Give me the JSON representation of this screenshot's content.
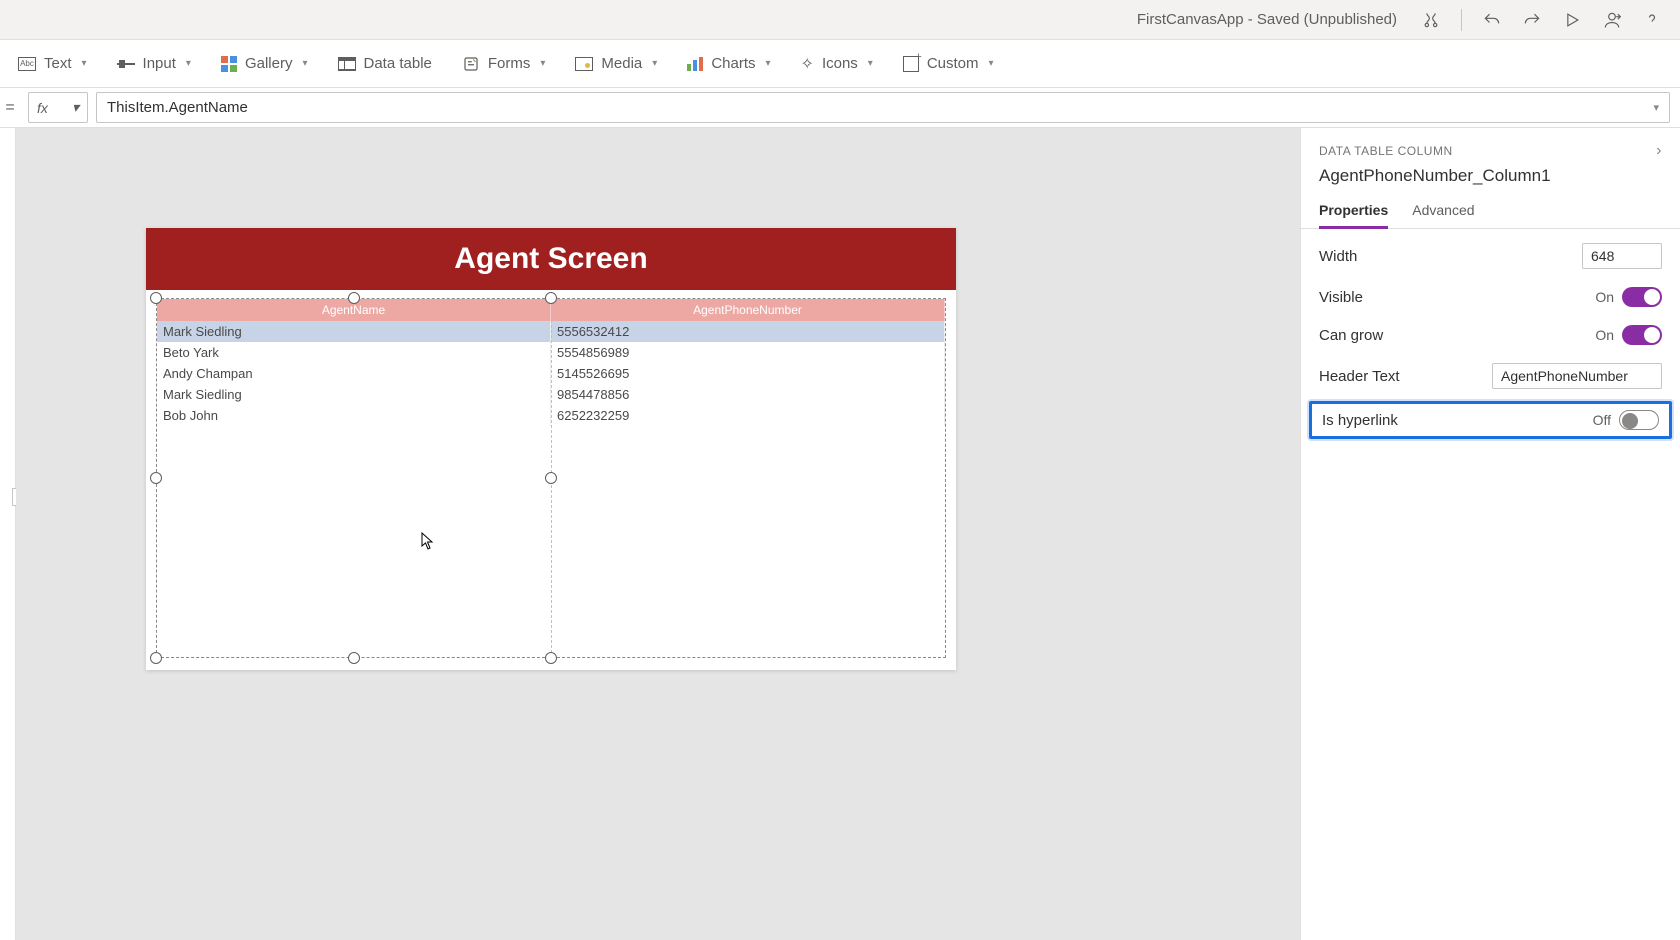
{
  "titlebar": {
    "app_title": "FirstCanvasApp - Saved (Unpublished)"
  },
  "ribbon": {
    "text": "Text",
    "input": "Input",
    "gallery": "Gallery",
    "datatable": "Data table",
    "forms": "Forms",
    "media": "Media",
    "charts": "Charts",
    "icons": "Icons",
    "custom": "Custom"
  },
  "formula": {
    "fx": "fx",
    "value": "ThisItem.AgentName"
  },
  "screen": {
    "header": "Agent Screen",
    "columns": [
      "AgentName",
      "AgentPhoneNumber"
    ],
    "rows": [
      {
        "AgentName": "Mark Siedling",
        "AgentPhoneNumber": "5556532412"
      },
      {
        "AgentName": "Beto Yark",
        "AgentPhoneNumber": "5554856989"
      },
      {
        "AgentName": "Andy Champan",
        "AgentPhoneNumber": "5145526695"
      },
      {
        "AgentName": "Mark Siedling",
        "AgentPhoneNumber": "9854478856"
      },
      {
        "AgentName": "Bob John",
        "AgentPhoneNumber": "6252232259"
      }
    ]
  },
  "props": {
    "caption": "DATA TABLE COLUMN",
    "object_name": "AgentPhoneNumber_Column1",
    "tabs": {
      "properties": "Properties",
      "advanced": "Advanced"
    },
    "width": {
      "label": "Width",
      "value": "648"
    },
    "visible": {
      "label": "Visible",
      "state": "On"
    },
    "cangrow": {
      "label": "Can grow",
      "state": "On"
    },
    "headertext": {
      "label": "Header Text",
      "value": "AgentPhoneNumber"
    },
    "ishyperlink": {
      "label": "Is hyperlink",
      "state": "Off"
    }
  }
}
